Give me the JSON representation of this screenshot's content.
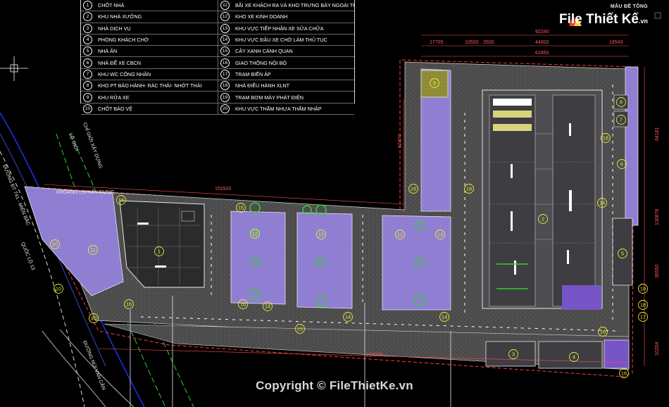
{
  "legend": {
    "left": [
      {
        "num": "1",
        "label": "CHỐT NHÀ"
      },
      {
        "num": "2",
        "label": "KHU NHÀ XƯỞNG"
      },
      {
        "num": "3",
        "label": "NHÀ DỊCH VỤ"
      },
      {
        "num": "4",
        "label": "PHÒNG KHÁCH CHỜ"
      },
      {
        "num": "5",
        "label": "NHÀ ĂN"
      },
      {
        "num": "6",
        "label": "NHÀ ĐỂ XE CBCN"
      },
      {
        "num": "7",
        "label": "KHU WC CÔNG NHÂN"
      },
      {
        "num": "8",
        "label": "KHO PT BẢO HÀNH- RÁC THẢI- NHỚT THẢI"
      },
      {
        "num": "9",
        "label": "KHU RỬA XE"
      },
      {
        "num": "10",
        "label": "CHỐT BẢO VỆ"
      }
    ],
    "right": [
      {
        "num": "11",
        "label": "BÃI XE KHÁCH RA VÀ KHO TRƯNG BÀY NGOÀI TRỜI"
      },
      {
        "num": "12",
        "label": "KHO XE KINH DOANH"
      },
      {
        "num": "13",
        "label": "KHU VỰC TIẾP NHẬN XE SỬA CHỮA"
      },
      {
        "num": "14",
        "label": "KHU VỰC ĐẬU XE CHỜ LÀM THỦ TỤC"
      },
      {
        "num": "15",
        "label": "CÂY XANH CẢNH QUAN"
      },
      {
        "num": "16",
        "label": "GIAO THÔNG NỘI BỘ"
      },
      {
        "num": "17",
        "label": "TRẠM BIẾN ÁP"
      },
      {
        "num": "18",
        "label": "NHÀ ĐIỀU HÀNH XLNT"
      },
      {
        "num": "19",
        "label": "TRẠM BƠM MÁY PHÁT ĐIỆN"
      },
      {
        "num": "20",
        "label": "KHU VỰC THẤM NHỰA THẤM NHẬP"
      }
    ]
  },
  "logo": {
    "top": "MẪU ĐỀ TÔNG",
    "brand": "File Thiết Kế",
    "domain": ".vn"
  },
  "copyright": "Copyright © FileThietKe.vn",
  "dimensions": {
    "top_total": "92240",
    "top_sub": "61850",
    "top_segments": [
      "17705",
      "10500",
      "3500",
      "44000",
      "16543"
    ],
    "mid_long": "152920",
    "bottom_long": "229270",
    "right_1": "64181",
    "right_2": "130878",
    "right_3": "36550",
    "right_4": "10204",
    "vertical_mid": "62470"
  },
  "labels": {
    "road_1": "LỘ GIỚI",
    "road_2": "CHỈ GIỚI XÂY DỰNG",
    "street_left": "ĐƯỜNG ĐT 741 - MIỀN BẮC",
    "street_mid": "QUỐC LỘ 13",
    "street_low": "ĐƯỜNG NÚI VẠN CÂN",
    "boundary_text": "KHOẢNG LÙI XÂY DỰNG"
  },
  "zone_markers": [
    {
      "num": "1"
    },
    {
      "num": "2"
    },
    {
      "num": "3"
    },
    {
      "num": "4"
    },
    {
      "num": "5"
    },
    {
      "num": "6"
    },
    {
      "num": "7"
    },
    {
      "num": "8"
    },
    {
      "num": "9"
    },
    {
      "num": "10"
    },
    {
      "num": "11"
    },
    {
      "num": "12"
    },
    {
      "num": "12"
    },
    {
      "num": "12"
    },
    {
      "num": "13"
    },
    {
      "num": "14"
    },
    {
      "num": "14"
    },
    {
      "num": "14"
    },
    {
      "num": "14"
    },
    {
      "num": "15"
    },
    {
      "num": "15"
    },
    {
      "num": "15"
    },
    {
      "num": "16"
    },
    {
      "num": "16"
    },
    {
      "num": "16"
    },
    {
      "num": "16"
    },
    {
      "num": "16"
    },
    {
      "num": "16"
    },
    {
      "num": "17"
    },
    {
      "num": "18"
    },
    {
      "num": "18"
    },
    {
      "num": "19"
    },
    {
      "num": "20"
    },
    {
      "num": "20"
    }
  ],
  "colors": {
    "background": "#000000",
    "paving": "#4a4a4a",
    "building_fill": "#4d4d52",
    "storage_purple": "#8f7dd2",
    "workshop_purple": "#7755c6",
    "wash_olive": "#8a8a2a",
    "boundary_red": "#ff3c3c",
    "axis_green": "#2fd12f",
    "tree_green": "#33d133",
    "dim_red": "#ff4c4c",
    "cyan_line": "#2fb8ff",
    "yellow_circle": "#eaea3a"
  }
}
